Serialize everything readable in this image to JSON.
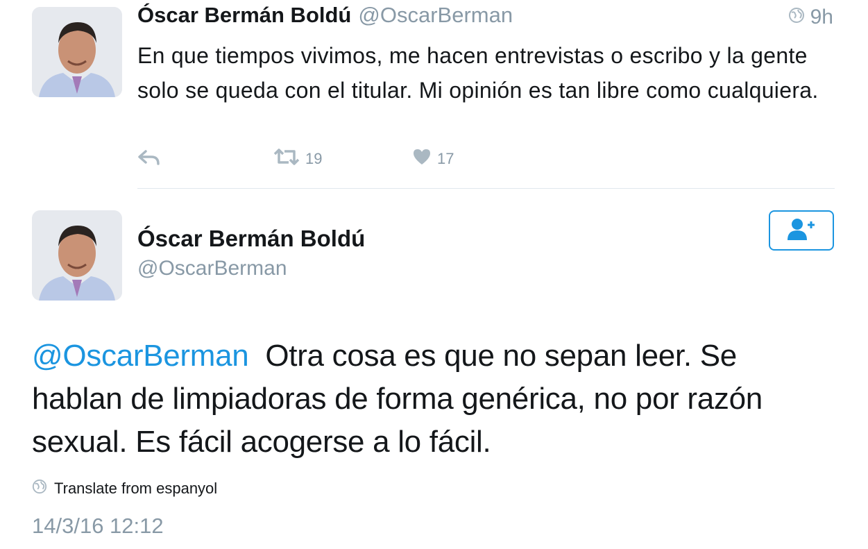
{
  "tweet1": {
    "author_name": "Óscar Bermán Boldú",
    "handle": "@OscarBerman",
    "time": "9h",
    "text": "En que tiempos vivimos, me hacen entrevistas o escribo y la gente solo se queda con el titular. Mi opinión es tan libre como cualquiera.",
    "retweet_count": "19",
    "like_count": "17"
  },
  "tweet2": {
    "author_name": "Óscar Bermán Boldú",
    "handle": "@OscarBerman",
    "mention": "@OscarBerman",
    "text": "Otra cosa es que no sepan leer. Se hablan de limpiadoras de forma genérica, no por razón sexual. Es fácil acogerse a lo fácil.",
    "translate_label": "Translate from espanyol",
    "timestamp": "14/3/16 12:12"
  },
  "colors": {
    "accent": "#1b95e0",
    "muted": "#8899a6",
    "text": "#14171a",
    "divider": "#e1e8ed"
  },
  "icons": [
    "globe-icon",
    "reply-icon",
    "retweet-icon",
    "heart-icon",
    "follow-user-icon"
  ]
}
